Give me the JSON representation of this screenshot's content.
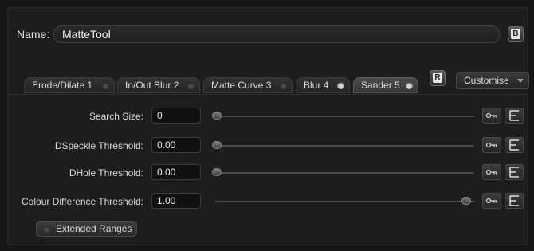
{
  "name": {
    "label": "Name:",
    "value": "MatteTool",
    "b_button": "B"
  },
  "tabs": [
    {
      "label": "Erode/Dilate 1",
      "led_on": false
    },
    {
      "label": "In/Out Blur 2",
      "led_on": false
    },
    {
      "label": "Matte Curve 3",
      "led_on": false
    },
    {
      "label": "Blur 4",
      "led_on": true
    },
    {
      "label": "Sander 5",
      "led_on": true,
      "active": true
    }
  ],
  "r_button": "R",
  "customise": "Customise",
  "params": [
    {
      "label": "Search Size:",
      "value": "0",
      "slider_fraction": 0.0
    },
    {
      "label": "DSpeckle Threshold:",
      "value": "0.00",
      "slider_fraction": 0.0
    },
    {
      "label": "DHole Threshold:",
      "value": "0.00",
      "slider_fraction": 0.0
    },
    {
      "label": "Colour Difference Threshold:",
      "value": "1.00",
      "slider_fraction": 1.0
    }
  ],
  "extended_ranges": "Extended Ranges"
}
